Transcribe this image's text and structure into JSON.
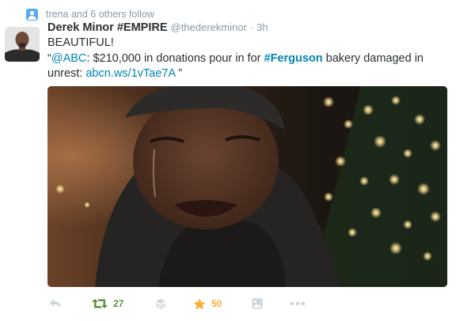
{
  "context": {
    "text": "trena and 6 others follow",
    "icon": "follow-user-icon"
  },
  "tweet": {
    "author": {
      "display_name": "Derek Minor #EMPIRE",
      "username": "@thederekminor",
      "separator": "·",
      "timestamp": "3h"
    },
    "text": {
      "line1": "BEAUTIFUL!",
      "open_quote": "“",
      "mention": "@ABC",
      "middle": ": $210,000 in donations pour in for ",
      "hashtag": "#Ferguson",
      "end": " bakery damaged in unrest: ",
      "url": "abcn.ws/1vTae7A",
      "close_quote": " ”"
    },
    "actions": {
      "reply": {
        "icon": "reply-icon"
      },
      "retweet": {
        "icon": "retweet-icon",
        "count": "27",
        "color": "#5c913b"
      },
      "buffer": {
        "icon": "stack-icon"
      },
      "favorite": {
        "icon": "star-icon",
        "count": "50",
        "color": "#ffac33"
      },
      "photo": {
        "icon": "photo-icon"
      },
      "more": {
        "icon": "more-icon"
      }
    }
  },
  "colors": {
    "link": "#0084b4",
    "muted": "#8899a6",
    "icon_gray": "#ccd6dd",
    "accent": "#55acee"
  }
}
